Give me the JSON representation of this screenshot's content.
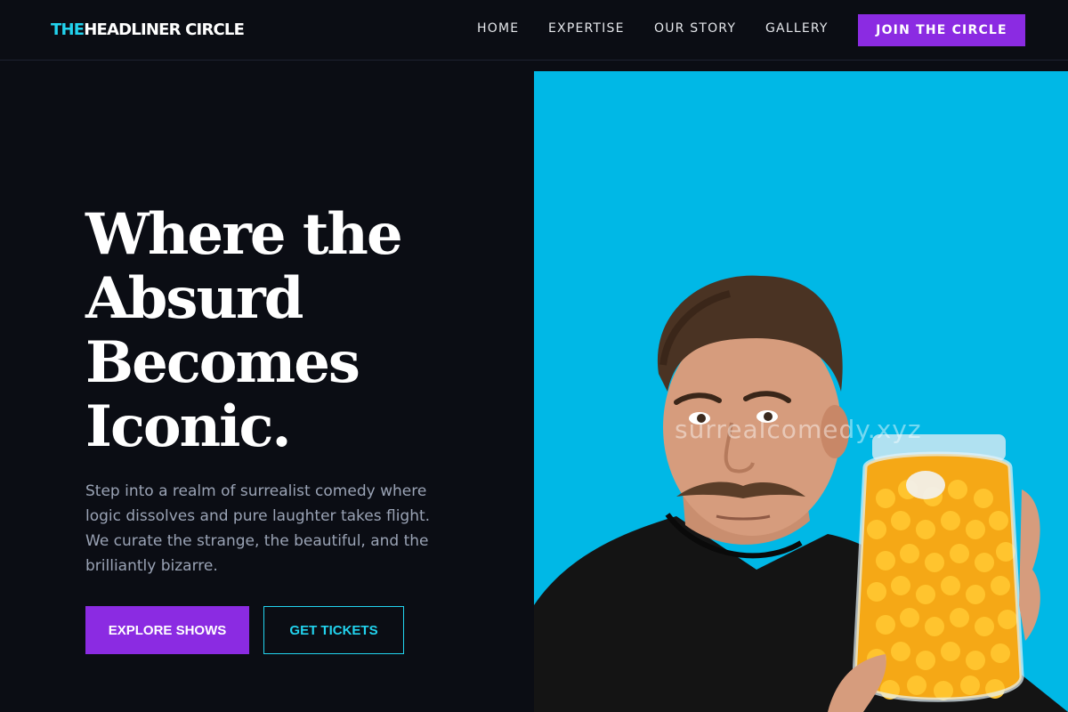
{
  "brand": {
    "accent_text": "THE",
    "rest_text": "HEADLINER CIRCLE",
    "accent_color": "#22d3ee",
    "primary_color": "#8b2be2"
  },
  "nav": {
    "items": [
      {
        "label": "HOME"
      },
      {
        "label": "EXPERTISE"
      },
      {
        "label": "OUR STORY"
      },
      {
        "label": "GALLERY"
      }
    ],
    "cta_label": "JOIN THE CIRCLE"
  },
  "hero": {
    "title_lines": [
      "Where the",
      "Absurd",
      "Becomes",
      "Iconic."
    ],
    "description": "Step into a realm of surrealist comedy where logic dissolves and pure laughter takes flight. We curate the strange, the beautiful, and the brilliantly bizarre.",
    "primary_button": "EXPLORE SHOWS",
    "secondary_button": "GET TICKETS",
    "image": {
      "subject": "man with mustache holding a jar of cheese puffs",
      "background_color": "#00b8e6",
      "watermark": "surrealcomedy.xyz"
    }
  }
}
